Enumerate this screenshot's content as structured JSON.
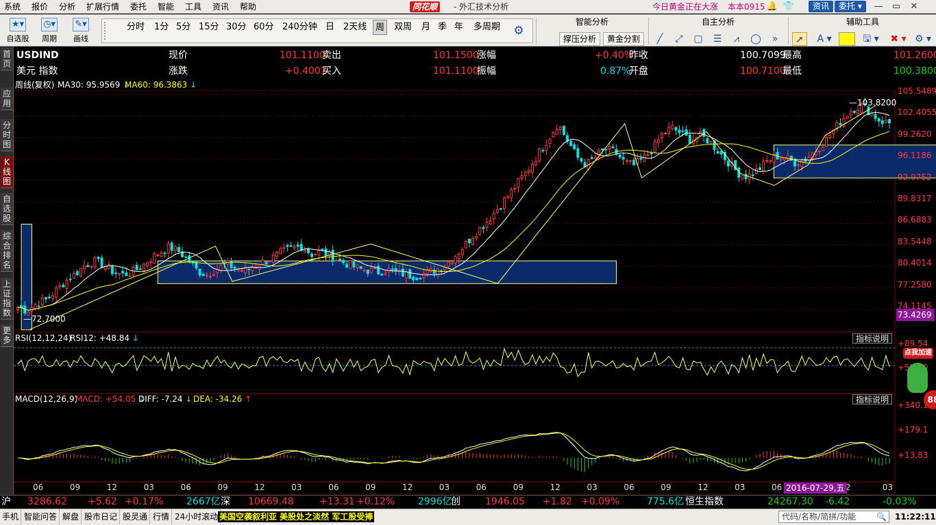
{
  "menubar": {
    "items": [
      "系统",
      "报价",
      "分析",
      "扩展行情",
      "委托",
      "智能",
      "工具",
      "资讯",
      "帮助"
    ],
    "brand": "同花顺",
    "title": "- 外汇技术分析",
    "news": "今日黄金正在大涨",
    "version": "本本0915",
    "btn_info": "资讯",
    "btn_trade": "委托"
  },
  "toolbar": {
    "watchlist_label": "自选股",
    "cycle_label": "周期",
    "draw_label": "画线",
    "periods": [
      "分时",
      "1分",
      "5分",
      "15分",
      "30分",
      "60分",
      "240分钟",
      "日",
      "2天线",
      "周",
      "双周",
      "月",
      "季",
      "年",
      "多周期"
    ],
    "active_period": "周",
    "smart_title": "智能分析",
    "smart_btn1": "撑压分析",
    "smart_btn2": "黄金分割",
    "draw_title": "自主分析",
    "aux_title": "辅助工具",
    "yellow_swatch": "#ffff00"
  },
  "sidebar": {
    "tabs": [
      "首页",
      "应用",
      "分时图",
      "K线图",
      "自选股",
      "综合排名",
      "上证指数",
      "更多"
    ],
    "active": "K线图"
  },
  "header": {
    "symbol": "USDIND",
    "name": "美元 指数",
    "r1": [
      {
        "label": "现价",
        "value": "101.1100"
      },
      {
        "label": "卖出",
        "value": "101.1500"
      },
      {
        "label": "涨幅",
        "value": "+0.40%"
      },
      {
        "label": "昨收",
        "value": "100.7099"
      },
      {
        "label": "最高",
        "value": "101.2600"
      }
    ],
    "r2": [
      {
        "label": "涨跌",
        "value": "+0.4001"
      },
      {
        "label": "买入",
        "value": "101.1100"
      },
      {
        "label": "振幅",
        "value": "0.87%"
      },
      {
        "label": "开盘",
        "value": "100.7100"
      },
      {
        "label": "最低",
        "value": "100.3800"
      }
    ]
  },
  "ma_line": {
    "period": "周线(复权)",
    "ma30_label": "MA30: 95.9569",
    "ma60_label": "MA60: 96.3863"
  },
  "price_axis": [
    "105.5489",
    "102.4055",
    "99.2620",
    "96.1186",
    "92.9752",
    "89.8317",
    "86.6883",
    "83.5448",
    "80.4014",
    "77.2580",
    "74.1145"
  ],
  "current_price_tag": "73.4269",
  "high_mark": "103.8200",
  "low_mark": "72.7000",
  "rsi": {
    "label": "RSI(12,12,24)",
    "value_label": "RSI12: +48.84",
    "axis": [
      "+89.54",
      "+58.40"
    ],
    "btn": "指标说明"
  },
  "macd": {
    "label": "MACD(12,26,9)",
    "macd_label": "MACD: +54.05",
    "diff_label": "DIFF: -7.24",
    "dea_label": "DEA: -34.26",
    "axis": [
      "+340.1",
      "+179.1",
      "+13.83"
    ],
    "btn": "指标说明"
  },
  "time_axis": [
    "06",
    "09",
    "12",
    "03",
    "06",
    "09",
    "12",
    "03",
    "06",
    "09",
    "12",
    "03",
    "06",
    "09",
    "12",
    "03",
    "06",
    "09",
    "12",
    "03",
    "06",
    "09",
    "2",
    "03"
  ],
  "cursor_date": "2016-07-29,五",
  "chart_data": {
    "type": "candlestick",
    "title": "USDIND",
    "xlabel": "",
    "ylabel": "",
    "ylim": [
      72.7,
      105.5489
    ],
    "close": [
      76.0,
      75.5,
      76.5,
      77.0,
      78.2,
      79.5,
      80.5,
      81.6,
      82.3,
      81.8,
      80.9,
      80.4,
      80.7,
      81.5,
      82.6,
      83.5,
      84.2,
      83.6,
      82.4,
      80.9,
      80.4,
      81.2,
      81.9,
      81.3,
      80.9,
      81.6,
      82.2,
      82.8,
      83.6,
      84.1,
      84.3,
      83.2,
      83.6,
      83.0,
      82.3,
      81.8,
      81.2,
      81.0,
      80.8,
      81.1,
      80.7,
      80.4,
      80.2,
      80.6,
      81.0,
      81.6,
      82.8,
      84.2,
      85.7,
      87.0,
      88.4,
      90.0,
      91.6,
      93.3,
      95.0,
      97.0,
      99.0,
      101.0,
      98.8,
      96.5,
      95.4,
      96.5,
      97.5,
      97.2,
      95.8,
      95.3,
      96.2,
      97.6,
      99.5,
      100.5,
      99.7,
      98.8,
      99.4,
      98.6,
      97.2,
      95.8,
      94.3,
      93.8,
      94.6,
      95.8,
      96.6,
      96.4,
      95.7,
      96.0,
      97.1,
      98.3,
      99.9,
      101.6,
      102.9,
      103.5,
      102.6,
      101.4,
      101.1
    ],
    "ma_short": [],
    "rsi12_last": 48.84,
    "macd_last": 54.05,
    "diff_last": -7.24,
    "dea_last": -34.26,
    "high": 103.82,
    "low": 72.7
  },
  "indexbar": {
    "sh_label": "沪",
    "sh_val": "3286.62",
    "sh_chg": "+5.62",
    "sh_pct": "+0.17%",
    "sh_amt": "2667亿",
    "sz_label": "深",
    "sz_val": "10669.48",
    "sz_chg": "+13.31",
    "sz_pct": "+0.12%",
    "sz_amt": "2996亿",
    "cy_label": "创",
    "cy_val": "1946.05",
    "cy_chg": "+1.82",
    "cy_pct": "+0.09%",
    "cy_amt": "775.6亿",
    "hs_label": "恒生指数",
    "hs_val": "24267.30",
    "hs_chg": "-6.42",
    "hs_pct": "-0.03%"
  },
  "statusbar": {
    "items": [
      "手机",
      "智能问答",
      "解盘",
      "股市日记",
      "股灵通",
      "行情",
      "24小时滚动"
    ],
    "ticker": "美国空袭叙利亚 美股处之淡然 军工股受捧",
    "search_placeholder": "代码/名称/简拼/功能",
    "clock": "11:22:11"
  },
  "widget": {
    "tag": "点我加速",
    "ball": "88"
  }
}
